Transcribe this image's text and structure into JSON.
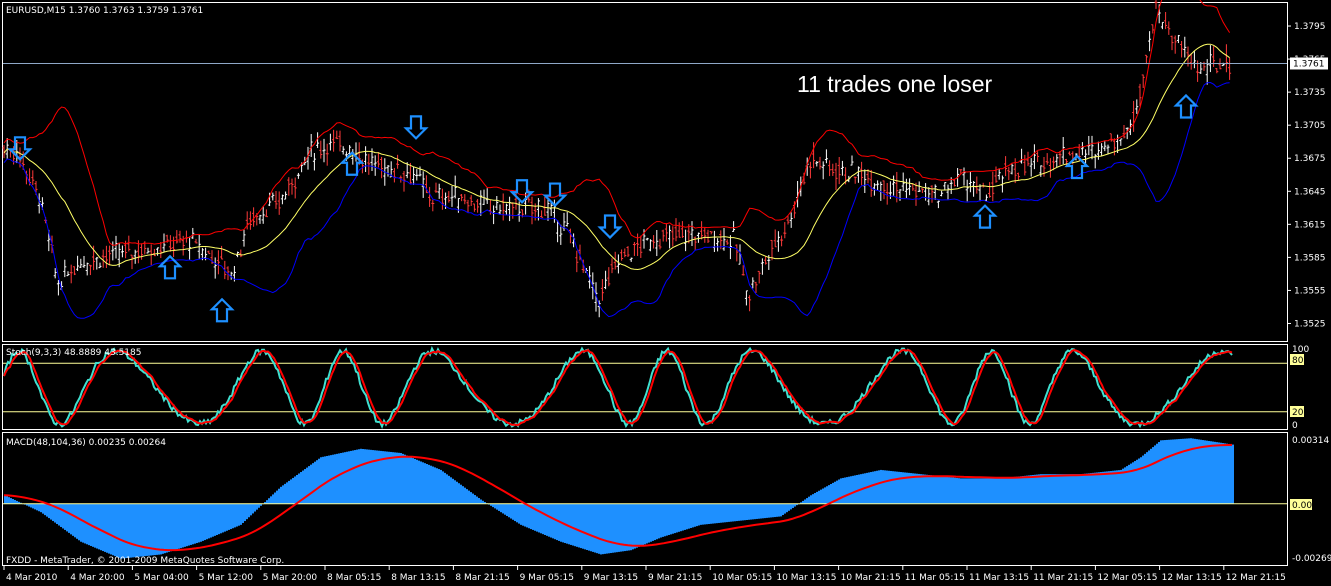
{
  "main_panel": {
    "header": "EURUSD,M15  1.3760 1.3763 1.3759 1.3761",
    "annotation": "11 trades one loser",
    "current_price_label": "1.3761",
    "current_price": 1.3761,
    "price_scale": [
      "1.3795",
      "1.3765",
      "1.3735",
      "1.3705",
      "1.3675",
      "1.3645",
      "1.3615",
      "1.3585",
      "1.3555",
      "1.3525"
    ],
    "ylim": [
      1.351,
      1.3815
    ]
  },
  "stoch_panel": {
    "header": "Stoch(9,3,3) 48.8889 43.5185",
    "scale": [
      "100",
      "80",
      "20",
      "0"
    ],
    "levels": [
      80,
      20
    ]
  },
  "macd_panel": {
    "header": "MACD(48,104,36) 0.00235 0.00264",
    "scale": [
      "0.00314",
      "0.00",
      "-0.00269"
    ],
    "ylim": [
      -0.0029,
      0.0033
    ]
  },
  "time_axis": [
    "4 Mar 2010",
    "4 Mar 20:00",
    "5 Mar 04:00",
    "5 Mar 12:00",
    "5 Mar 20:00",
    "8 Mar 05:15",
    "8 Mar 13:15",
    "8 Mar 21:15",
    "9 Mar 05:15",
    "9 Mar 13:15",
    "9 Mar 21:15",
    "10 Mar 05:15",
    "10 Mar 13:15",
    "10 Mar 21:15",
    "11 Mar 05:15",
    "11 Mar 13:15",
    "11 Mar 21:15",
    "12 Mar 05:15",
    "12 Mar 13:15",
    "12 Mar 21:15"
  ],
  "copyright": "FXDD - MetaTrader, © 2001-2009 MetaQuotes Software Corp.",
  "colors": {
    "background": "#000000",
    "upper_band": "#ff0000",
    "lower_band": "#0000ff",
    "middle_ma": "#ffff66",
    "candle_up": "#ffffff",
    "candle_down": "#ff3a3a",
    "arrow": "#1e90ff",
    "stoch_main": "#40e0d0",
    "stoch_signal": "#ff0000",
    "macd_histogram": "#1e90ff",
    "macd_signal": "#ff0000",
    "level_line": "#ffff99"
  },
  "chart_data": {
    "type": "line",
    "title": "EURUSD,M15",
    "price_path": [
      [
        0,
        1.3685
      ],
      [
        18,
        1.368
      ],
      [
        40,
        1.364
      ],
      [
        58,
        1.356
      ],
      [
        78,
        1.358
      ],
      [
        100,
        1.3585
      ],
      [
        130,
        1.359
      ],
      [
        160,
        1.3595
      ],
      [
        190,
        1.36
      ],
      [
        220,
        1.358
      ],
      [
        232,
        1.357
      ],
      [
        250,
        1.362
      ],
      [
        280,
        1.3635
      ],
      [
        310,
        1.368
      ],
      [
        330,
        1.3688
      ],
      [
        350,
        1.3685
      ],
      [
        370,
        1.367
      ],
      [
        395,
        1.3665
      ],
      [
        415,
        1.366
      ],
      [
        430,
        1.364
      ],
      [
        460,
        1.364
      ],
      [
        490,
        1.363
      ],
      [
        520,
        1.363
      ],
      [
        545,
        1.363
      ],
      [
        570,
        1.3605
      ],
      [
        598,
        1.3545
      ],
      [
        620,
        1.3585
      ],
      [
        650,
        1.36
      ],
      [
        680,
        1.3605
      ],
      [
        710,
        1.3605
      ],
      [
        735,
        1.36
      ],
      [
        748,
        1.355
      ],
      [
        770,
        1.359
      ],
      [
        790,
        1.362
      ],
      [
        810,
        1.3675
      ],
      [
        835,
        1.3665
      ],
      [
        860,
        1.366
      ],
      [
        890,
        1.365
      ],
      [
        920,
        1.3645
      ],
      [
        940,
        1.364
      ],
      [
        960,
        1.366
      ],
      [
        985,
        1.364
      ],
      [
        1010,
        1.3665
      ],
      [
        1040,
        1.367
      ],
      [
        1070,
        1.368
      ],
      [
        1090,
        1.368
      ],
      [
        1110,
        1.369
      ],
      [
        1130,
        1.37
      ],
      [
        1145,
        1.376
      ],
      [
        1155,
        1.381
      ],
      [
        1170,
        1.379
      ],
      [
        1185,
        1.377
      ],
      [
        1200,
        1.3755
      ],
      [
        1215,
        1.376
      ],
      [
        1232,
        1.3761
      ]
    ],
    "signals": [
      {
        "type": "sell",
        "bar_pos": 20,
        "price": 1.3694
      },
      {
        "type": "buy",
        "bar_pos": 170,
        "price": 1.3566
      },
      {
        "type": "buy",
        "bar_pos": 222,
        "price": 1.3527
      },
      {
        "type": "buy",
        "bar_pos": 352,
        "price": 1.366
      },
      {
        "type": "sell",
        "bar_pos": 416,
        "price": 1.3713
      },
      {
        "type": "sell",
        "bar_pos": 522,
        "price": 1.3655
      },
      {
        "type": "sell",
        "bar_pos": 555,
        "price": 1.3652
      },
      {
        "type": "sell",
        "bar_pos": 610,
        "price": 1.3623
      },
      {
        "type": "buy",
        "bar_pos": 985,
        "price": 1.3612
      },
      {
        "type": "buy",
        "bar_pos": 1077,
        "price": 1.3657
      },
      {
        "type": "buy",
        "bar_pos": 1186,
        "price": 1.3712
      }
    ]
  }
}
